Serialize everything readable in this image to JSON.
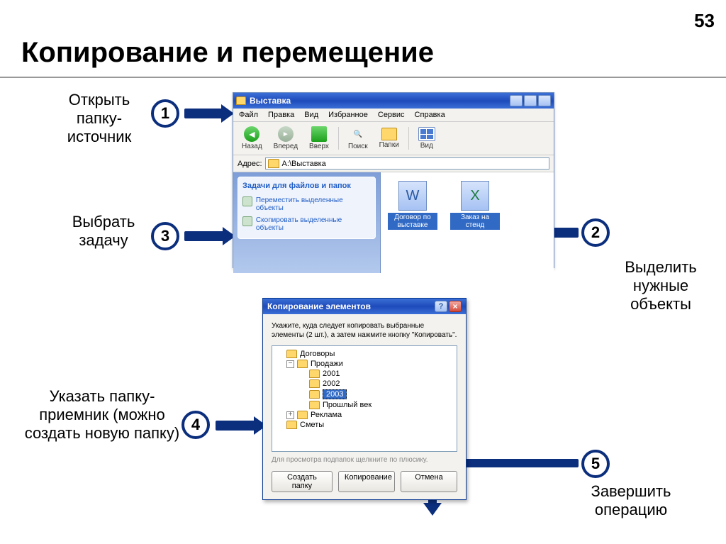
{
  "page_number": "53",
  "title": "Копирование и перемещение",
  "steps": {
    "s1": {
      "num": "1",
      "label": "Открыть папку-источник"
    },
    "s2": {
      "num": "2",
      "label": "Выделить нужные объекты"
    },
    "s3": {
      "num": "3",
      "label": "Выбрать задачу"
    },
    "s4": {
      "num": "4",
      "label": "Указать папку-приемник (можно создать новую папку)"
    },
    "s5": {
      "num": "5",
      "label": "Завершить операцию"
    }
  },
  "explorer": {
    "title": "Выставка",
    "menu": {
      "m0": "Файл",
      "m1": "Правка",
      "m2": "Вид",
      "m3": "Избранное",
      "m4": "Сервис",
      "m5": "Справка"
    },
    "toolbar": {
      "back": "Назад",
      "fwd": "Вперед",
      "up": "Вверх",
      "search": "Поиск",
      "folders": "Папки",
      "view": "Вид"
    },
    "addr_label": "Адрес:",
    "addr_value": "A:\\Выставка",
    "taskpane_title": "Задачи для файлов и папок",
    "task_move": "Переместить выделенные объекты",
    "task_copy": "Скопировать выделенные объекты",
    "file1": "Договор по выставке",
    "file2": "Заказ на стенд"
  },
  "dialog": {
    "title": "Копирование элементов",
    "instr": "Укажите, куда следует копировать выбранные элементы (2 шт.), а затем нажмите кнопку \"Копировать\".",
    "tree": {
      "n0": "Договоры",
      "n1": "Продажи",
      "n2": "2001",
      "n3": "2002",
      "n4": "2003",
      "n5": "Прошлый век",
      "n6": "Реклама",
      "n7": "Сметы"
    },
    "hint": "Для просмотра подпапок щелкните по плюсику.",
    "btn_new": "Создать папку",
    "btn_copy": "Копирование",
    "btn_cancel": "Отмена"
  }
}
